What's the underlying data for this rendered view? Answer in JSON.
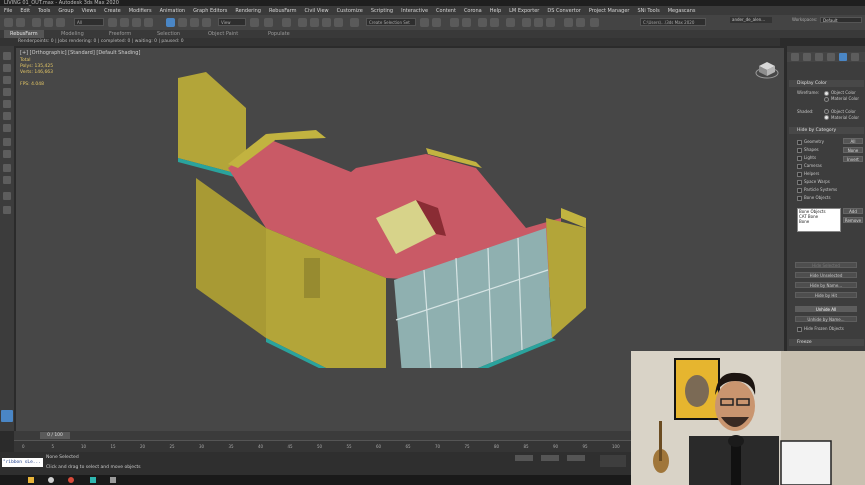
{
  "window": {
    "title": "LIVING 01_OUT.max - Autodesk 3ds Max 2020"
  },
  "menu": [
    "File",
    "Edit",
    "Tools",
    "Group",
    "Views",
    "Create",
    "Modifiers",
    "Animation",
    "Graph Editors",
    "Rendering",
    "RebusFarm",
    "Civil View",
    "Customize",
    "Scripting",
    "Interactive",
    "Content",
    "Corona",
    "Help",
    "LM Exporter",
    "DS Convertor",
    "Project Manager",
    "SNi Tools",
    "Megascans"
  ],
  "user": {
    "name": "ander_de_alen...",
    "workspaces_label": "Workspaces:",
    "workspace_value": "Default"
  },
  "toolbar": {
    "filter": "All",
    "view": "View",
    "selection_set": "Create Selection Set",
    "path": "C:\\Users\\...\\3ds Max 2020"
  },
  "ribbon_tabs": [
    "RebusFarm",
    "Modeling",
    "Freeform",
    "Selection",
    "Object Paint",
    "Populate"
  ],
  "render_status": "Renderpoints: 0 | Jobs rendering: 0 | completed: 0 | waiting: 0 | paused: 0",
  "viewport": {
    "label": "[+] [Orthographic] [Standard] [Default Shading]",
    "stats_total": "Total",
    "polys_label": "Polys:",
    "polys": "135,425",
    "verts_label": "Verts:",
    "verts": "146,663",
    "fps_label": "FPS:",
    "fps": "4.048"
  },
  "panel": {
    "display_color": "Display Color",
    "wireframe": "Wireframe:",
    "object_color": "Object Color",
    "material_color": "Material Color",
    "shaded": "Shaded:",
    "hide_by_category": "Hide by Category",
    "categories": [
      "Geometry",
      "Shapes",
      "Lights",
      "Cameras",
      "Helpers",
      "Space Warps",
      "Particle Systems",
      "Bone Objects"
    ],
    "btn_all": "All",
    "btn_none": "None",
    "btn_invert": "Invert",
    "list_items": [
      "Bone Objects",
      "CAT Bone",
      "Bone"
    ],
    "btn_add": "Add",
    "btn_remove": "Remove",
    "hide_selected": "Hide Selected",
    "hide_unselected": "Hide Unselected",
    "hide_by_name": "Hide by Name...",
    "hide_by_hit": "Hide by Hit",
    "unhide_all": "Unhide All",
    "unhide_by_name": "Unhide by Name...",
    "hide_frozen": "Hide Frozen Objects",
    "freeze": "Freeze"
  },
  "timeline": {
    "frame": "0 / 100",
    "ticks": [
      "0",
      "5",
      "10",
      "15",
      "20",
      "25",
      "30",
      "35",
      "40",
      "45",
      "50",
      "55",
      "60",
      "65",
      "70",
      "75",
      "80",
      "85",
      "90",
      "95",
      "100"
    ]
  },
  "status": {
    "script": "\"ribbon sLe...",
    "selection": "None Selected",
    "prompt": "Click and drag to select and move objects"
  },
  "colors": {
    "wall": "#b8a93a",
    "roof": "#c95a66",
    "glass": "#8fb0b0",
    "teal": "#2fb7b0",
    "bg": "#474747"
  }
}
